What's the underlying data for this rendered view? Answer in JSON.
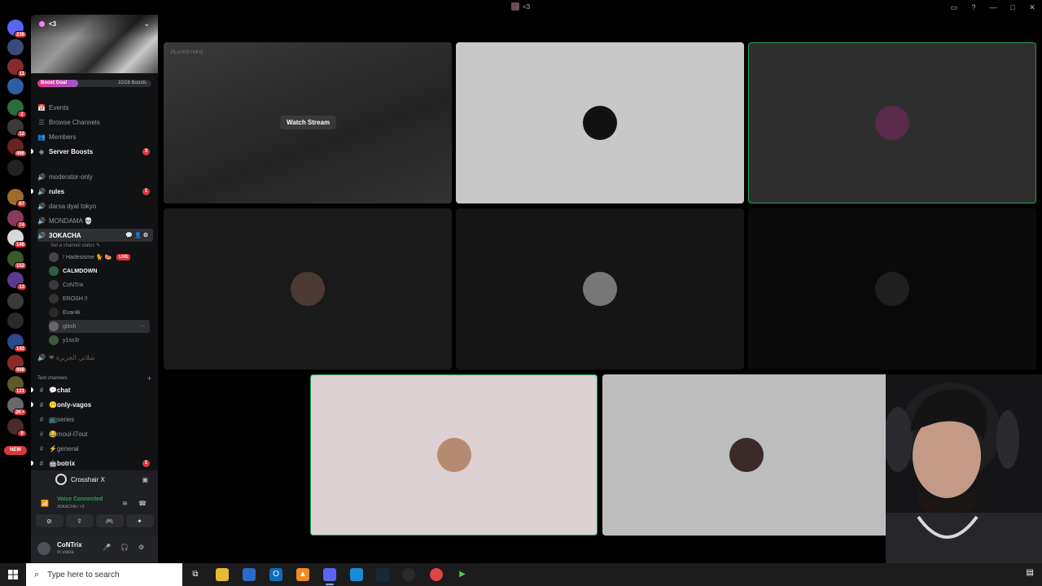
{
  "window": {
    "title": "<3"
  },
  "server": {
    "name": "<3",
    "boost_goal": "Boost Goal",
    "boost_count": "10/28 Boosts",
    "boost_progress": 0.36
  },
  "nav": [
    {
      "icon": "calendar-icon",
      "label": "Events",
      "bold": false,
      "badge": ""
    },
    {
      "icon": "browse-icon",
      "label": "Browse Channels",
      "bold": false,
      "badge": ""
    },
    {
      "icon": "members-icon",
      "label": "Members",
      "bold": false,
      "badge": ""
    },
    {
      "icon": "boost-icon",
      "label": "Server Boosts",
      "bold": true,
      "badge": "3"
    }
  ],
  "voice_channels": [
    {
      "label": "moderator-only",
      "bold": false,
      "badge": ""
    },
    {
      "label": "rules",
      "bold": true,
      "badge": "1"
    },
    {
      "label": "darsa dyal tokyo",
      "bold": false,
      "badge": ""
    },
    {
      "label": "MONDAMA 💀",
      "bold": false,
      "badge": ""
    }
  ],
  "active_channel": {
    "label": "3OKACHA",
    "status": "Set a channel status ✎"
  },
  "voice_users": [
    {
      "name": "! Hadesisme 🐈 🍉",
      "live": "LIVE",
      "bold": false
    },
    {
      "name": "CALMDOWN",
      "live": "",
      "bold": true
    },
    {
      "name": "CoNTrix",
      "live": "",
      "bold": false
    },
    {
      "name": "EROSH !!",
      "live": "",
      "bold": false
    },
    {
      "name": "Evar4k",
      "live": "",
      "bold": false
    },
    {
      "name": "glitxh",
      "live": "",
      "bold": false
    },
    {
      "name": "y1ss3r",
      "live": "",
      "bold": false
    }
  ],
  "extra_voice": {
    "label": "❤ شلاتي الجزيرة"
  },
  "text_category": "Text channels",
  "text_channels": [
    {
      "label": "💬chat",
      "bold": true,
      "badge": ""
    },
    {
      "label": "😶only-vagos",
      "bold": true,
      "badge": ""
    },
    {
      "label": "📺series",
      "bold": false,
      "badge": ""
    },
    {
      "label": "😂moul-l7out",
      "bold": false,
      "badge": ""
    },
    {
      "label": "⚡general",
      "bold": false,
      "badge": ""
    },
    {
      "label": "🤖botrix",
      "bold": true,
      "badge": "1"
    }
  ],
  "activity": {
    "name": "Crosshair X"
  },
  "voice": {
    "status": "Voice Connected",
    "location": "3OKACHA / <3"
  },
  "user": {
    "name": "CoNTrix",
    "status": "In voice"
  },
  "stage": {
    "watch_label": "Watch Stream",
    "stream_overlay_text": "PLAYER INFO",
    "tiles": [
      {
        "name": "stream-tile",
        "bg": "#2a2a2a"
      },
      {
        "name": "participant-tile-2",
        "bg": "#c8c8c8"
      },
      {
        "name": "participant-tile-3",
        "bg": "#2e2e2e",
        "speaking": true
      },
      {
        "name": "participant-tile-4",
        "bg": "#1a1a1a"
      },
      {
        "name": "participant-tile-5",
        "bg": "#151515"
      },
      {
        "name": "participant-tile-6",
        "bg": "#0a0a0a"
      },
      {
        "name": "participant-tile-7",
        "bg": "#dcd0d2",
        "speaking": true
      },
      {
        "name": "participant-tile-8",
        "bg": "#bdbdbd"
      }
    ]
  },
  "taskbar": {
    "search_placeholder": "Type here to search",
    "apps": [
      "task-view-icon",
      "file-explorer-icon",
      "store-icon",
      "outlook-icon",
      "vlc-icon",
      "discord-icon",
      "edge-icon",
      "steam-icon",
      "obs-icon",
      "chrome-icon",
      "game-icon"
    ]
  }
}
